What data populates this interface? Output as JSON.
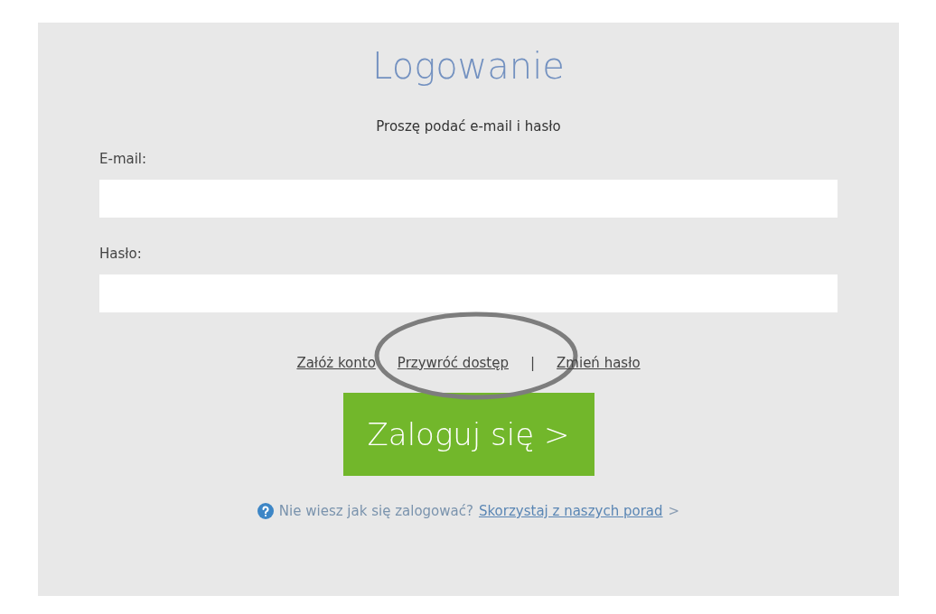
{
  "title": "Logowanie",
  "subtitle": "Proszę podać e-mail i hasło",
  "fields": [
    {
      "label": "E-mail:"
    },
    {
      "label": "Hasło:"
    }
  ],
  "links": [
    {
      "label": "Załóż konto"
    },
    {
      "label": "Przywróć dostęp",
      "separator": "|",
      "circled": true
    },
    {
      "label": "Zmień hasło"
    }
  ],
  "submit": "Zaloguj się >",
  "help": {
    "question": "Nie wiesz jak się zalogować?",
    "link": "Skorzystaj z naszych porad",
    "arrow": ">"
  }
}
